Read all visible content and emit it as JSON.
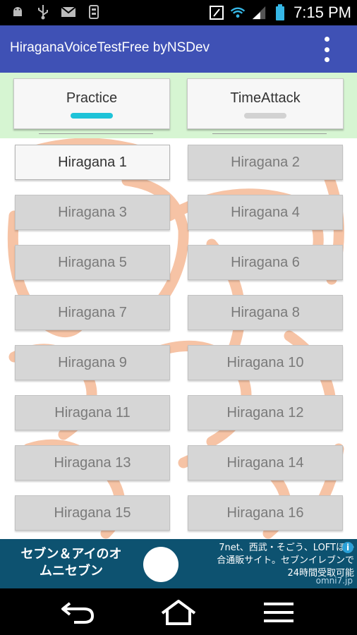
{
  "status_bar": {
    "time": "7:15 PM",
    "left_icons": [
      "android-icon",
      "usb-icon",
      "mail-icon",
      "download-icon"
    ],
    "right_icons": [
      "nfc-icon",
      "wifi-icon",
      "signal-icon",
      "battery-icon"
    ]
  },
  "app_bar": {
    "title": "HiraganaVoiceTestFree byNSDev",
    "menu_icon": "overflow-menu-icon",
    "color": "#3F51B5"
  },
  "tabs": [
    {
      "label": "Practice",
      "selected": true,
      "indicator_color": "#1ec3d8"
    },
    {
      "label": "TimeAttack",
      "selected": false,
      "indicator_color": "#d2d2d2"
    }
  ],
  "grid": {
    "buttons": [
      {
        "label": "Hiragana 1",
        "active": true
      },
      {
        "label": "Hiragana 2",
        "active": false
      },
      {
        "label": "Hiragana 3",
        "active": false
      },
      {
        "label": "Hiragana 4",
        "active": false
      },
      {
        "label": "Hiragana 5",
        "active": false
      },
      {
        "label": "Hiragana 6",
        "active": false
      },
      {
        "label": "Hiragana 7",
        "active": false
      },
      {
        "label": "Hiragana 8",
        "active": false
      },
      {
        "label": "Hiragana 9",
        "active": false
      },
      {
        "label": "Hiragana 10",
        "active": false
      },
      {
        "label": "Hiragana 11",
        "active": false
      },
      {
        "label": "Hiragana 12",
        "active": false
      },
      {
        "label": "Hiragana 13",
        "active": false
      },
      {
        "label": "Hiragana 14",
        "active": false
      },
      {
        "label": "Hiragana 15",
        "active": false
      },
      {
        "label": "Hiragana 16",
        "active": false
      }
    ]
  },
  "ad": {
    "left_text_line1": "セブン＆アイのオ",
    "left_text_line2": "ムニセブン",
    "right_text_line1": "7net、西武・そごう、LOFTほか",
    "right_text_line2": "合通販サイト。セブンイレブンで",
    "right_text_line3": "24時間受取可能",
    "url": "omni7.jp",
    "info": "i",
    "background": "#0d5270"
  },
  "nav_bar": {
    "items": [
      "back-icon",
      "home-icon",
      "recent-apps-icon"
    ]
  }
}
